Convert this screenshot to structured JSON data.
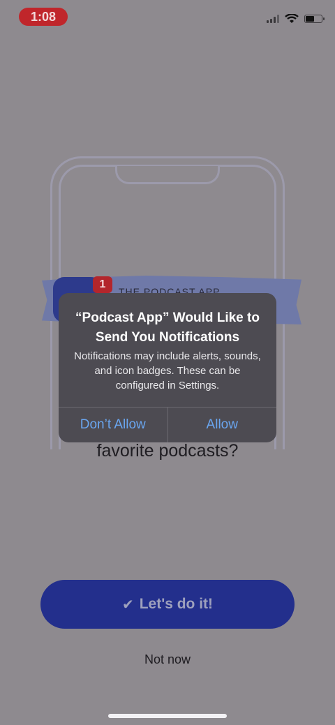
{
  "status_bar": {
    "time": "1:08"
  },
  "illustration": {
    "badge_count": "1",
    "banner_title": "THE PODCAST APP"
  },
  "question_partial": "favorite podcasts?",
  "alert": {
    "title": "“Podcast App” Would Like to Send You Notifications",
    "message": "Notifications may include alerts, sounds, and icon badges. These can be configured in Settings.",
    "deny_label": "Don’t Allow",
    "allow_label": "Allow",
    "action_color": "#6aa6f0"
  },
  "cta": {
    "label": "Let's do it!",
    "icon": "checkmark-icon"
  },
  "secondary": {
    "label": "Not now"
  },
  "colors": {
    "accent": "#232f8c",
    "badge": "#b3262c"
  }
}
